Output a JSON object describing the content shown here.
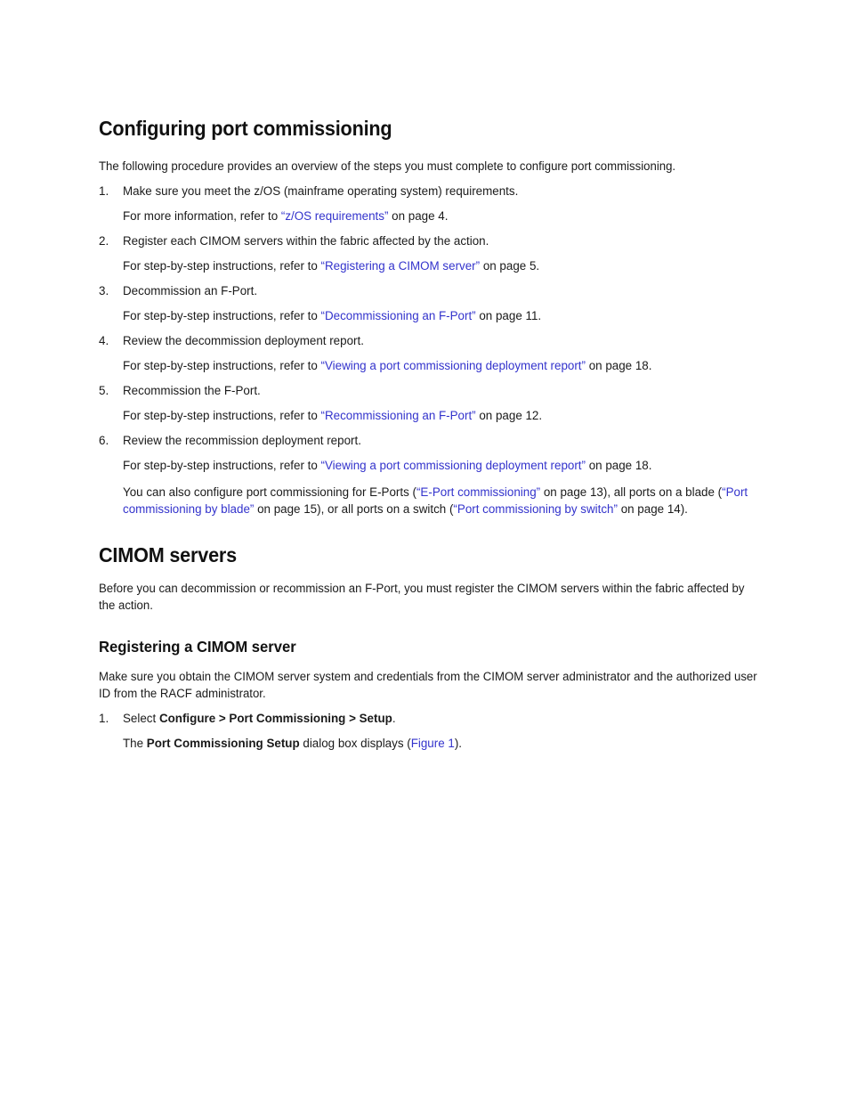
{
  "document": {
    "link_color": "#3333cc",
    "text_color": "#1a1a1a"
  },
  "section1": {
    "heading": "Configuring port commissioning",
    "intro": "The following procedure provides an overview of the steps you must complete to configure port commissioning.",
    "steps": [
      {
        "number": "1.",
        "text": "Make sure you meet the z/OS (mainframe operating system) requirements.",
        "detail_prefix": "For more information, refer to ",
        "detail_link": "“z/OS requirements”",
        "detail_suffix": " on page 4."
      },
      {
        "number": "2.",
        "text": "Register each CIMOM servers within the fabric affected by the action.",
        "detail_prefix": "For step-by-step instructions, refer to ",
        "detail_link": "“Registering a CIMOM server”",
        "detail_suffix": " on page 5."
      },
      {
        "number": "3.",
        "text": "Decommission an F-Port.",
        "detail_prefix": "For step-by-step instructions, refer to ",
        "detail_link": "“Decommissioning an F-Port”",
        "detail_suffix": " on page 11."
      },
      {
        "number": "4.",
        "text": "Review the decommission deployment report.",
        "detail_prefix": "For step-by-step instructions, refer to ",
        "detail_link": "“Viewing a port commissioning deployment report”",
        "detail_suffix": " on page 18."
      },
      {
        "number": "5.",
        "text": "Recommission the F-Port.",
        "detail_prefix": "For step-by-step instructions, refer to ",
        "detail_link": "“Recommissioning an F-Port”",
        "detail_suffix": " on page 12."
      },
      {
        "number": "6.",
        "text": "Review the recommission deployment report.",
        "detail_prefix": "For step-by-step instructions, refer to ",
        "detail_link": "“Viewing a port commissioning deployment report”",
        "detail_suffix": " on page 18."
      }
    ],
    "closing_paragraph": {
      "part1": "You can also configure port commissioning for E-Ports (",
      "link1": "“E-Port commissioning”",
      "part2": " on page 13), all ports on a blade (",
      "link2": "“Port commissioning by blade”",
      "part3": " on page 15), or all ports on a switch (",
      "link3": "“Port commissioning by switch”",
      "part4": " on page 14)."
    }
  },
  "section2": {
    "heading": "CIMOM servers",
    "intro": "Before you can decommission or recommission an F-Port, you must register the CIMOM servers within the fabric affected by the action.",
    "subsection": {
      "heading": "Registering a CIMOM server",
      "intro": "Make sure you obtain the CIMOM server system and credentials from the CIMOM server administrator and the authorized user ID from the RACF administrator.",
      "step": {
        "number": "1.",
        "prefix": "Select ",
        "bold_menu_path": "Configure > Port Commissioning > Setup",
        "suffix": ".",
        "detail_prefix": "The ",
        "detail_bold": "Port Commissioning Setup",
        "detail_middle": " dialog box displays (",
        "detail_link": "Figure 1",
        "detail_suffix": ")."
      }
    }
  }
}
